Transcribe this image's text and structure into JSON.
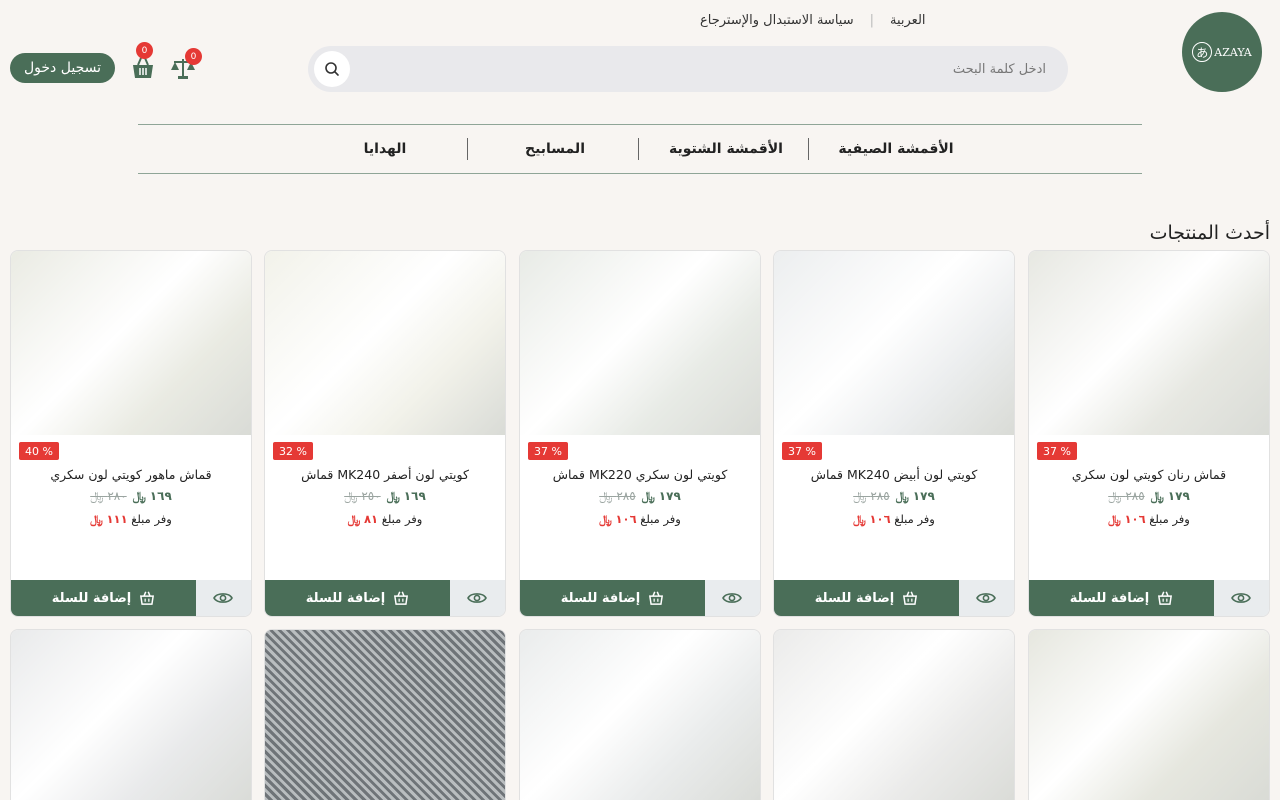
{
  "header": {
    "logo_text": "AZAYA",
    "logo_glyph": "あ",
    "language_link": "العربية",
    "policy_link": "سياسة الاستبدال والإسترجاع",
    "search_placeholder": "ادخل كلمة البحث",
    "compare_count": "0",
    "cart_count": "0",
    "login_label": "تسجيل دخول"
  },
  "nav": {
    "items": [
      "الأقمشة الصيفية",
      "الأقمشة الشتوية",
      "المسابيح",
      "الهدايا"
    ]
  },
  "section": {
    "title": "أحدث المنتجات"
  },
  "labels": {
    "add_to_cart": "إضافة للسلة",
    "save_prefix": "وفر مبلغ",
    "currency": "﷼"
  },
  "products": [
    {
      "name": "قماش رنان كويتي لون سكري",
      "discount": "37 %",
      "price": "١٧٩",
      "old_price": "٢٨٥",
      "saving": "١٠٦",
      "img_tone": "#e7e8e2"
    },
    {
      "name": "قماش MK240 كويتي لون أبيض",
      "discount": "37 %",
      "price": "١٧٩",
      "old_price": "٢٨٥",
      "saving": "١٠٦",
      "img_tone": "#eceeef"
    },
    {
      "name": "قماش MK220 كويتي لون سكري",
      "discount": "37 %",
      "price": "١٧٩",
      "old_price": "٢٨٥",
      "saving": "١٠٦",
      "img_tone": "#e8ebe6"
    },
    {
      "name": "قماش MK240 كويتي لون أصفر",
      "discount": "32 %",
      "price": "١٦٩",
      "old_price": "٢٥٠",
      "saving": "٨١",
      "img_tone": "#f2f2ea"
    },
    {
      "name": "قماش ماهور كويتي لون سكري",
      "discount": "40 %",
      "price": "١٦٩",
      "old_price": "٢٨٠",
      "saving": "١١١",
      "img_tone": "#eaebe3"
    }
  ],
  "row2_tones": [
    "#e9eaeb",
    "#7f8488",
    "#eaecec",
    "#ebebea",
    "#e6e7df"
  ]
}
